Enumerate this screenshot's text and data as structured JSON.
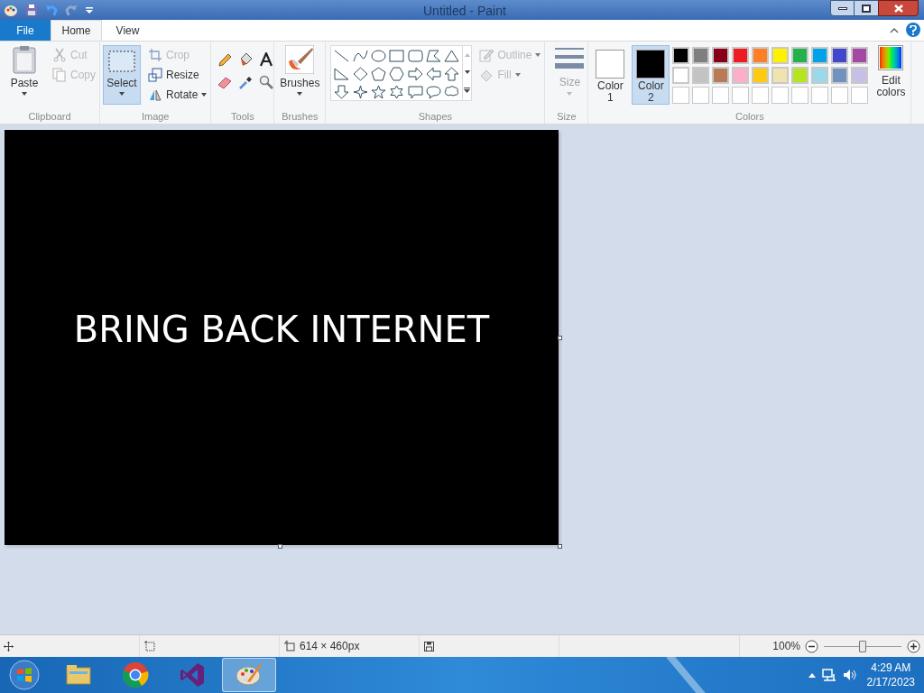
{
  "window": {
    "title": "Untitled - Paint"
  },
  "tabs": [
    {
      "label": "File",
      "selected": false,
      "kind": "file"
    },
    {
      "label": "Home",
      "selected": true,
      "kind": "tab"
    },
    {
      "label": "View",
      "selected": false,
      "kind": "tab"
    }
  ],
  "ribbon": {
    "clipboard": {
      "label": "Clipboard",
      "paste": "Paste",
      "cut": {
        "label": "Cut",
        "disabled": true
      },
      "copy": {
        "label": "Copy",
        "disabled": true
      }
    },
    "image": {
      "label": "Image",
      "select": {
        "label": "Select",
        "selected": true
      },
      "crop": {
        "label": "Crop",
        "disabled": true
      },
      "resize": {
        "label": "Resize",
        "disabled": false
      },
      "rotate": {
        "label": "Rotate",
        "disabled": false
      }
    },
    "tools": {
      "label": "Tools"
    },
    "brushes": {
      "label": "Brushes",
      "button": "Brushes"
    },
    "shapes": {
      "label": "Shapes",
      "outline": {
        "label": "Outline",
        "disabled": true
      },
      "fill": {
        "label": "Fill",
        "disabled": true
      }
    },
    "size": {
      "label": "Size",
      "button": "Size",
      "disabled": true
    },
    "colors": {
      "label": "Colors",
      "color1": {
        "label": "Color\n1",
        "color": "#ffffff",
        "selected": false
      },
      "color2": {
        "label": "Color\n2",
        "color": "#000000",
        "selected": true
      },
      "palette": [
        {
          "color": "#000000"
        },
        {
          "color": "#7f7f7f"
        },
        {
          "color": "#880015"
        },
        {
          "color": "#ed1c24"
        },
        {
          "color": "#ff7f27"
        },
        {
          "color": "#fff200"
        },
        {
          "color": "#22b14c"
        },
        {
          "color": "#00a2e8"
        },
        {
          "color": "#3f48cc"
        },
        {
          "color": "#a349a4"
        },
        {
          "color": "#ffffff"
        },
        {
          "color": "#c3c3c3"
        },
        {
          "color": "#b97a57"
        },
        {
          "color": "#ffaec9"
        },
        {
          "color": "#ffc90e"
        },
        {
          "color": "#efe4b0"
        },
        {
          "color": "#b5e61d"
        },
        {
          "color": "#99d9ea"
        },
        {
          "color": "#7092be"
        },
        {
          "color": "#c8bfe7"
        }
      ],
      "edit": "Edit\ncolors"
    }
  },
  "canvas": {
    "text": "BRING BACK INTERNET"
  },
  "status_bar": {
    "size": "614 × 460px",
    "zoom": "100%",
    "zoom_level": {
      "level": 0.5
    }
  },
  "taskbar": {
    "apps": [
      {
        "kind": "explorer",
        "selected": false
      },
      {
        "kind": "chrome",
        "selected": false
      },
      {
        "kind": "studio",
        "selected": false
      },
      {
        "kind": "paint",
        "selected": true
      }
    ],
    "time": "4:29 AM",
    "date": "2/17/2023"
  }
}
